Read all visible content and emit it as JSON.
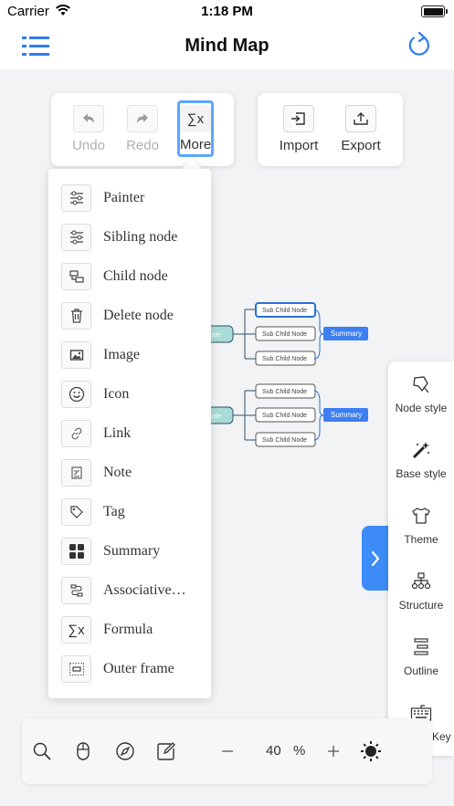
{
  "status_bar": {
    "carrier": "Carrier",
    "time": "1:18 PM"
  },
  "nav": {
    "title": "Mind Map",
    "menu_icon": "list-icon",
    "refresh_icon": "refresh-icon"
  },
  "toolbar_edit": [
    {
      "label": "Undo",
      "icon": "undo-icon",
      "state": "disabled"
    },
    {
      "label": "Redo",
      "icon": "redo-icon",
      "state": "disabled"
    },
    {
      "label": "More",
      "icon": "sigma-icon",
      "state": "selected"
    }
  ],
  "toolbar_file": [
    {
      "label": "Import",
      "icon": "import-icon"
    },
    {
      "label": "Export",
      "icon": "export-icon"
    }
  ],
  "more_menu": [
    {
      "label": "Painter",
      "icon": "sliders-icon"
    },
    {
      "label": "Sibling node",
      "icon": "sliders-icon"
    },
    {
      "label": "Child node",
      "icon": "child-node-icon"
    },
    {
      "label": "Delete node",
      "icon": "trash-icon"
    },
    {
      "label": "Image",
      "icon": "image-icon"
    },
    {
      "label": "Icon",
      "icon": "smiley-icon"
    },
    {
      "label": "Link",
      "icon": "link-icon"
    },
    {
      "label": "Note",
      "icon": "note-icon"
    },
    {
      "label": "Tag",
      "icon": "tag-icon"
    },
    {
      "label": "Summary",
      "icon": "grid-icon"
    },
    {
      "label": "Associative…",
      "icon": "associative-icon"
    },
    {
      "label": "Formula",
      "icon": "sigma-icon"
    },
    {
      "label": "Outer frame",
      "icon": "frame-icon"
    }
  ],
  "mindmap": {
    "groups": [
      {
        "parent_label": "ode",
        "children": [
          "Sub Child Node",
          "Sub Child Node",
          "Sub Child Node"
        ],
        "summary": "Summary"
      },
      {
        "parent_label": "ode",
        "children": [
          "Sub Child Node",
          "Sub Child Node",
          "Sub Child Node"
        ],
        "summary": "Summary"
      }
    ]
  },
  "right_panel": [
    {
      "label": "Node style",
      "icon": "node-style-icon"
    },
    {
      "label": "Base style",
      "icon": "magic-wand-icon"
    },
    {
      "label": "Theme",
      "icon": "shirt-icon"
    },
    {
      "label": "Structure",
      "icon": "structure-icon"
    },
    {
      "label": "Outline",
      "icon": "outline-icon"
    },
    {
      "label": "ShortcutKey",
      "icon": "keyboard-icon"
    }
  ],
  "bottom_bar": {
    "zoom_value": "40",
    "zoom_unit": "%",
    "icons": [
      "search-icon",
      "mouse-icon",
      "compass-icon",
      "edit-icon",
      "minus-icon",
      "plus-icon",
      "brightness-icon"
    ]
  },
  "colors": {
    "accent": "#3d8bf7",
    "summary_bg": "#3d7ff0",
    "parent_node": "#a9dcd6",
    "node_border": "#2a6fd6"
  }
}
